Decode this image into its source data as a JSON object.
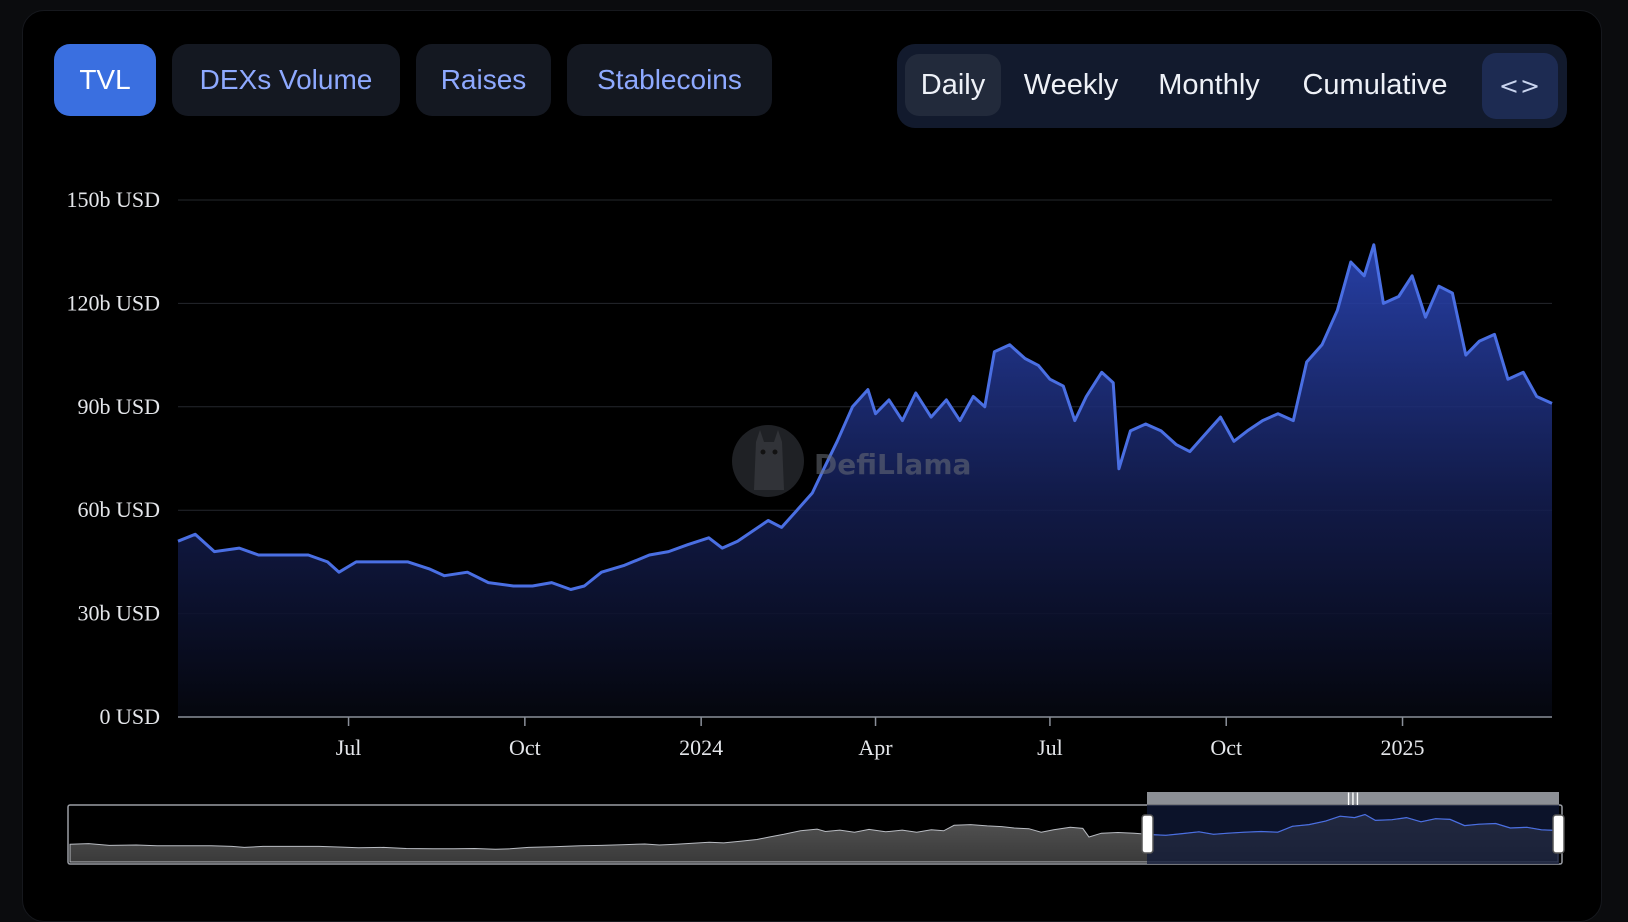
{
  "tabs": [
    {
      "label": "TVL",
      "active": true
    },
    {
      "label": "DEXs Volume",
      "active": false
    },
    {
      "label": "Raises",
      "active": false
    },
    {
      "label": "Stablecoins",
      "active": false
    }
  ],
  "periods": [
    {
      "label": "Daily",
      "active": true
    },
    {
      "label": "Weekly",
      "active": false
    },
    {
      "label": "Monthly",
      "active": false
    },
    {
      "label": "Cumulative",
      "active": false
    }
  ],
  "embed_label": "<>",
  "watermark": {
    "text": "DefiLlama"
  },
  "colors": {
    "line": "#4a6fe3",
    "active_tab": "#3a6fe0",
    "tab_text": "#8ea9ff"
  },
  "chart_data": {
    "type": "area",
    "title": "",
    "xlabel": "",
    "ylabel": "",
    "ylim": [
      0,
      150
    ],
    "yunit": "b USD",
    "y_ticks": [
      "0 USD",
      "30b USD",
      "60b USD",
      "90b USD",
      "120b USD",
      "150b USD"
    ],
    "y_tick_values": [
      0,
      30,
      60,
      90,
      120,
      150
    ],
    "x_ticks": [
      "Jul",
      "Oct",
      "2024",
      "Apr",
      "Jul",
      "Oct",
      "2025"
    ],
    "x_tick_dates": [
      "2023-07-01",
      "2023-10-01",
      "2024-01-01",
      "2024-04-01",
      "2024-07-01",
      "2024-10-01",
      "2025-01-01"
    ],
    "xlim": [
      "2023-04-03",
      "2025-03-20"
    ],
    "grid": true,
    "series": [
      {
        "points": [
          [
            "2023-04-03",
            51
          ],
          [
            "2023-04-12",
            53
          ],
          [
            "2023-04-22",
            48
          ],
          [
            "2023-05-05",
            49
          ],
          [
            "2023-05-15",
            47
          ],
          [
            "2023-05-28",
            47
          ],
          [
            "2023-06-10",
            47
          ],
          [
            "2023-06-20",
            45
          ],
          [
            "2023-06-26",
            42
          ],
          [
            "2023-07-05",
            45
          ],
          [
            "2023-07-20",
            45
          ],
          [
            "2023-08-01",
            45
          ],
          [
            "2023-08-12",
            43
          ],
          [
            "2023-08-20",
            41
          ],
          [
            "2023-09-01",
            42
          ],
          [
            "2023-09-12",
            39
          ],
          [
            "2023-09-25",
            38
          ],
          [
            "2023-10-05",
            38
          ],
          [
            "2023-10-15",
            39
          ],
          [
            "2023-10-25",
            37
          ],
          [
            "2023-11-01",
            38
          ],
          [
            "2023-11-10",
            42
          ],
          [
            "2023-11-22",
            44
          ],
          [
            "2023-12-05",
            47
          ],
          [
            "2023-12-15",
            48
          ],
          [
            "2023-12-25",
            50
          ],
          [
            "2024-01-05",
            52
          ],
          [
            "2024-01-12",
            49
          ],
          [
            "2024-01-20",
            51
          ],
          [
            "2024-01-28",
            54
          ],
          [
            "2024-02-05",
            57
          ],
          [
            "2024-02-12",
            55
          ],
          [
            "2024-02-20",
            60
          ],
          [
            "2024-02-28",
            65
          ],
          [
            "2024-03-05",
            72
          ],
          [
            "2024-03-12",
            80
          ],
          [
            "2024-03-20",
            90
          ],
          [
            "2024-03-28",
            95
          ],
          [
            "2024-04-01",
            88
          ],
          [
            "2024-04-08",
            92
          ],
          [
            "2024-04-15",
            86
          ],
          [
            "2024-04-22",
            94
          ],
          [
            "2024-04-30",
            87
          ],
          [
            "2024-05-08",
            92
          ],
          [
            "2024-05-15",
            86
          ],
          [
            "2024-05-22",
            93
          ],
          [
            "2024-05-28",
            90
          ],
          [
            "2024-06-02",
            106
          ],
          [
            "2024-06-10",
            108
          ],
          [
            "2024-06-18",
            104
          ],
          [
            "2024-06-25",
            102
          ],
          [
            "2024-07-01",
            98
          ],
          [
            "2024-07-08",
            96
          ],
          [
            "2024-07-14",
            86
          ],
          [
            "2024-07-20",
            93
          ],
          [
            "2024-07-28",
            100
          ],
          [
            "2024-08-03",
            97
          ],
          [
            "2024-08-06",
            72
          ],
          [
            "2024-08-12",
            83
          ],
          [
            "2024-08-20",
            85
          ],
          [
            "2024-08-28",
            83
          ],
          [
            "2024-09-05",
            79
          ],
          [
            "2024-09-12",
            77
          ],
          [
            "2024-09-20",
            82
          ],
          [
            "2024-09-28",
            87
          ],
          [
            "2024-10-05",
            80
          ],
          [
            "2024-10-12",
            83
          ],
          [
            "2024-10-20",
            86
          ],
          [
            "2024-10-28",
            88
          ],
          [
            "2024-11-05",
            86
          ],
          [
            "2024-11-12",
            103
          ],
          [
            "2024-11-20",
            108
          ],
          [
            "2024-11-28",
            118
          ],
          [
            "2024-12-05",
            132
          ],
          [
            "2024-12-12",
            128
          ],
          [
            "2024-12-17",
            137
          ],
          [
            "2024-12-22",
            120
          ],
          [
            "2024-12-30",
            122
          ],
          [
            "2025-01-06",
            128
          ],
          [
            "2025-01-13",
            116
          ],
          [
            "2025-01-20",
            125
          ],
          [
            "2025-01-27",
            123
          ],
          [
            "2025-02-03",
            105
          ],
          [
            "2025-02-10",
            109
          ],
          [
            "2025-02-18",
            111
          ],
          [
            "2025-02-25",
            98
          ],
          [
            "2025-03-05",
            100
          ],
          [
            "2025-03-12",
            93
          ],
          [
            "2025-03-20",
            91
          ]
        ]
      }
    ]
  }
}
